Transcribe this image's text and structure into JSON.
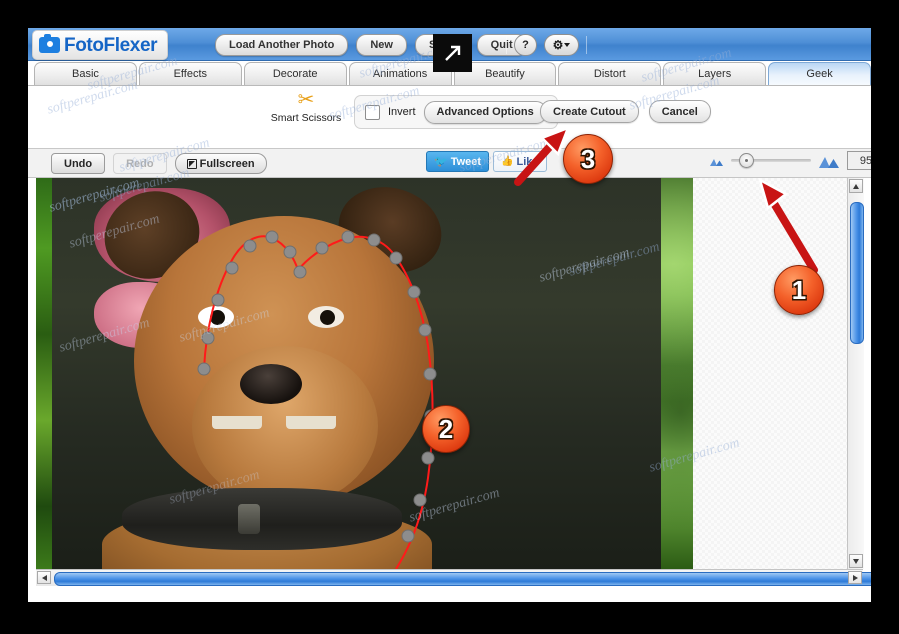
{
  "app": {
    "name": "FotoFlexer",
    "logo_icon": "camera-icon"
  },
  "header": {
    "buttons": [
      {
        "label": "Load Another Photo",
        "name": "load-another-photo-button"
      },
      {
        "label": "New",
        "name": "new-button"
      },
      {
        "label": "Save",
        "name": "save-button"
      },
      {
        "label": "Quit",
        "name": "quit-button"
      }
    ],
    "help_label": "?",
    "gear_icon": "gear-icon",
    "expand_icon": "expand-overlay-icon"
  },
  "tabs": [
    {
      "label": "Basic",
      "active": false
    },
    {
      "label": "Effects",
      "active": false
    },
    {
      "label": "Decorate",
      "active": false
    },
    {
      "label": "Animations",
      "active": false
    },
    {
      "label": "Beautify",
      "active": false
    },
    {
      "label": "Distort",
      "active": false
    },
    {
      "label": "Layers",
      "active": false
    },
    {
      "label": "Geek",
      "active": true
    }
  ],
  "tool_panel": {
    "tool_icon": "scissors-icon",
    "tool_name": "Smart Scissors",
    "invert_label": "Invert",
    "invert_checked": false,
    "advanced_options_label": "Advanced Options",
    "create_cutout_label": "Create Cutout",
    "cancel_label": "Cancel"
  },
  "editor_bar": {
    "undo_label": "Undo",
    "redo_label": "Redo",
    "redo_disabled": true,
    "fullscreen_label": "Fullscreen",
    "tweet_label": "Tweet",
    "like_label": "Like",
    "zoom_out_icon": "zoom-out-mountain-icon",
    "zoom_in_icon": "zoom-in-mountain-icon",
    "zoom_value": "95",
    "zoom_unit": "%"
  },
  "canvas": {
    "selection_color": "#ff1a1a",
    "node_color": "#888888",
    "subject": "dog photo with smart-scissors selection path"
  },
  "annotations": {
    "badges": [
      {
        "number": "1",
        "name": "annotation-badge-1"
      },
      {
        "number": "2",
        "name": "annotation-badge-2"
      },
      {
        "number": "3",
        "name": "annotation-badge-3"
      }
    ],
    "badge_color": "#f4612a"
  },
  "watermarks": {
    "text": "softperepair.com"
  }
}
